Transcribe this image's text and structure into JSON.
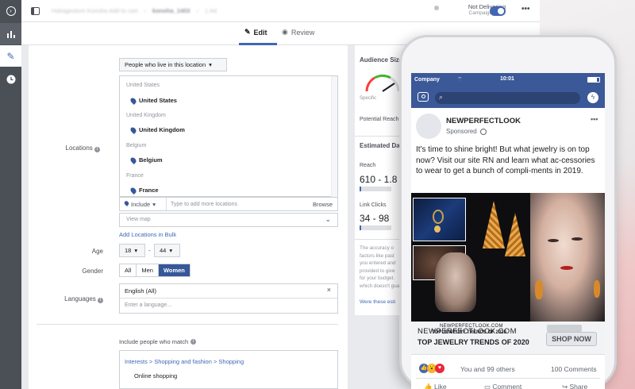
{
  "topbar": {
    "breadcrumb": [
      "Hakagestore Konoha Add to cart",
      "konoha_1403",
      "1 Ad"
    ],
    "status": "Not Delivering",
    "status_sub": "Campaign is Off",
    "more": "•••"
  },
  "tabs": [
    {
      "label": "Edit",
      "icon": "pencil-icon"
    },
    {
      "label": "Review",
      "icon": "eye-icon"
    }
  ],
  "form": {
    "location_type": "People who live in this location",
    "locations_label": "Locations",
    "locations": [
      {
        "country": "United States",
        "name": "United States"
      },
      {
        "country": "United Kingdom",
        "name": "United Kingdom"
      },
      {
        "country": "Belgium",
        "name": "Belgium"
      },
      {
        "country": "France",
        "name": "France"
      }
    ],
    "include": "Include",
    "loc_placeholder": "Type to add more locations",
    "browse": "Browse",
    "view_map": "View map",
    "add_bulk": "Add Locations in Bulk",
    "age_label": "Age",
    "age_min": "18",
    "age_max": "44",
    "age_sep": "-",
    "gender_label": "Gender",
    "genders": [
      "All",
      "Men",
      "Women"
    ],
    "gender_selected": "Women",
    "languages_label": "Languages",
    "language_value": "English (All)",
    "language_placeholder": "Enter a language...",
    "include_match": "Include people who match",
    "interest_path": "Interests > Shopping and fashion > Shopping",
    "interest": "Online shopping"
  },
  "sidebar": {
    "audience_size": "Audience Size",
    "specific": "Specific",
    "potential_reach": "Potential Reach",
    "estimated": "Estimated Da",
    "reach_label": "Reach",
    "reach_value": "610 - 1.8",
    "clicks_label": "Link Clicks",
    "clicks_value": "34 - 98",
    "reach_progress": 0.05,
    "clicks_progress": 0.05,
    "note": [
      "The accuracy o",
      "factors like past",
      "you entered and",
      "provided to give",
      "for your budget.",
      "which doesn't guarantee"
    ],
    "were": "Were these esti"
  },
  "phone": {
    "carrier": "Company",
    "time": "10:01",
    "page_name": "NEWPERFECTLOOK",
    "sponsored": "Sponsored",
    "post_text": "It's time to shine bright! But what jewelry is on top now? Visit our site RN and learn what ac-cessories to wear to get a bunch of compli-ments in 2019.",
    "url_small": "NEWPERFECTLOOK.COM",
    "title_small": "TOP JEWELRY TRENDS OF 2020",
    "url": "NEWPERFECTLOOK.COM",
    "title": "TOP JEWELRY TRENDS OF 2020",
    "cta": "SHOP NOW",
    "reactions": "You and 99 others",
    "comments": "100 Comments",
    "actions": [
      "Like",
      "Comment",
      "Share"
    ]
  },
  "colors": {
    "fb_blue": "#3b5998",
    "accent": "#4267b2",
    "rail": "#4b4f56"
  }
}
